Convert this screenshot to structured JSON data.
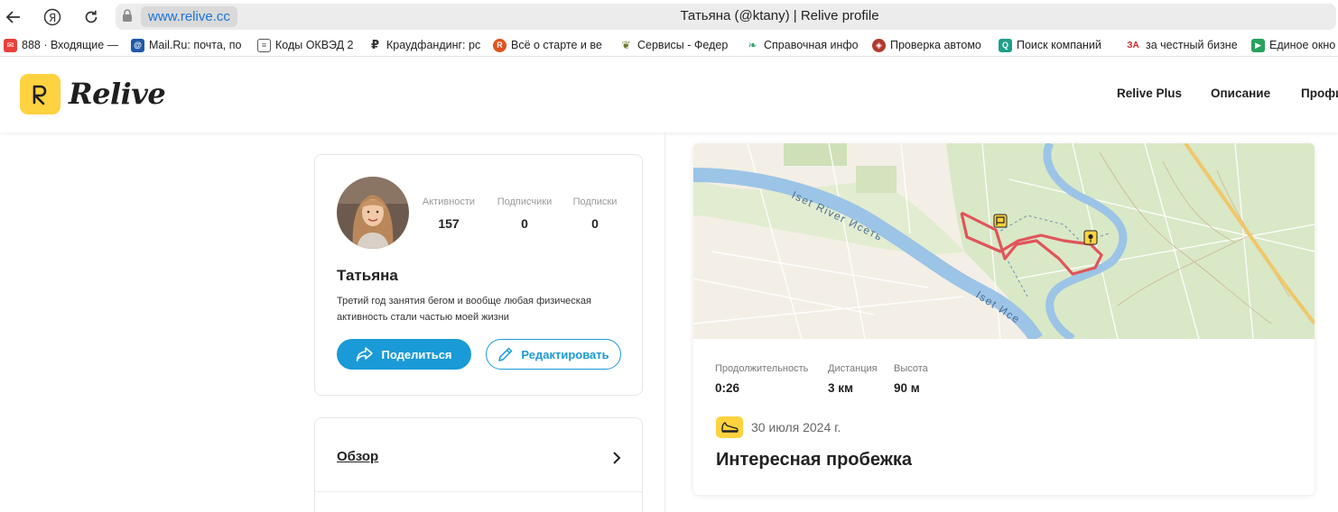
{
  "browser": {
    "url": "www.relive.cc",
    "page_title": "Татьяна (@ktany) | Relive profile",
    "bookmarks": [
      {
        "label": "888 · Входящие —",
        "icon": "mail-icon",
        "color": "#e8413c"
      },
      {
        "label": "Mail.Ru: почта, по",
        "icon": "at-icon",
        "color": "#1e5aa8"
      },
      {
        "label": "Коды ОКВЭД 2",
        "icon": "document-icon",
        "color": "#555555"
      },
      {
        "label": "Краудфандинг: рс",
        "icon": "ruble-icon",
        "color": "#333333"
      },
      {
        "label": "Всё о старте и ве",
        "icon": "r-badge-icon",
        "color": "#e0531f"
      },
      {
        "label": "Сервисы - Федер",
        "icon": "emblem-icon",
        "color": "#6c7a2a"
      },
      {
        "label": "Справочная инфо",
        "icon": "leaf-icon",
        "color": "#2ea36b"
      },
      {
        "label": "Проверка автомо",
        "icon": "shield-icon",
        "color": "#b03a2e"
      },
      {
        "label": "Поиск компаний",
        "icon": "search-square-icon",
        "color": "#1f9f8a"
      },
      {
        "label": "за честный бизне",
        "icon": "za-icon",
        "color": "#d6262c"
      },
      {
        "label": "Единое окно",
        "icon": "play-square-icon",
        "color": "#27a25c"
      }
    ]
  },
  "site": {
    "logo_text": "Relive",
    "nav": [
      "Relive Plus",
      "Описание",
      "Профи"
    ]
  },
  "profile": {
    "name": "Татьяна",
    "bio": "Третий год занятия бегом и вообще любая физическая активность стали частью моей жизни",
    "stats": [
      {
        "label": "Активности",
        "value": "157"
      },
      {
        "label": "Подписчики",
        "value": "0"
      },
      {
        "label": "Подписки",
        "value": "0"
      }
    ],
    "share_label": "Поделиться",
    "edit_label": "Редактировать"
  },
  "overview": {
    "label": "Обзор"
  },
  "activity": {
    "map_labels": [
      "Iset River Исеть",
      "Iset Исе"
    ],
    "metrics": [
      {
        "label": "Продолжительность",
        "value": "0:26"
      },
      {
        "label": "Дистанция",
        "value": "3 км"
      },
      {
        "label": "Высота",
        "value": "90 м"
      }
    ],
    "date": "30 июля 2024 г.",
    "title": "Интересная пробежка"
  },
  "colors": {
    "accent_blue": "#1a9ad6",
    "brand_yellow": "#ffd23f",
    "route_red": "#e0545a",
    "river_blue": "#9cc4e6"
  }
}
